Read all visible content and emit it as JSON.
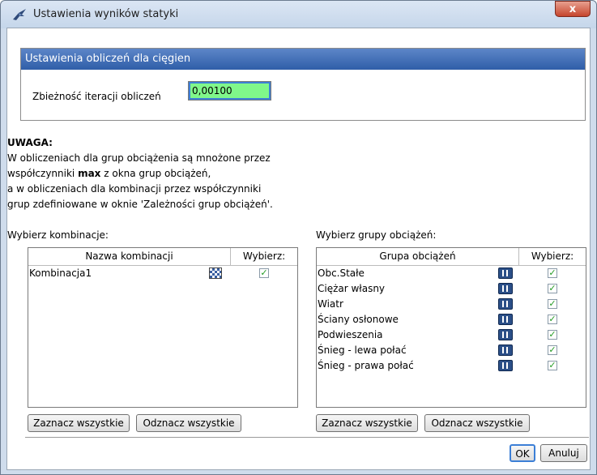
{
  "window": {
    "title": "Ustawienia wyników statyki",
    "close_label": "x"
  },
  "panel": {
    "header": "Ustawienia obliczeń dla cięgien",
    "convergence_label": "Zbieżność iteracji obliczeń",
    "convergence_value": "0,00100"
  },
  "note": {
    "title": "UWAGA:",
    "line1": "W obliczeniach dla grup obciążenia są mnożone przez",
    "line2_pre": "współczynniki ",
    "line2_bold": "max",
    "line2_post": " z okna grup obciążeń,",
    "line3": "a w obliczeniach dla kombinacji przez współczynniki",
    "line4": "grup zdefiniowane w oknie 'Zależności grup obciążeń'."
  },
  "combinations": {
    "label": "Wybierz kombinacje:",
    "col_name": "Nazwa kombinacji",
    "col_select": "Wybierz:",
    "rows": [
      {
        "name": "Kombinacja1",
        "checked": true
      }
    ],
    "select_all": "Zaznacz wszystkie",
    "deselect_all": "Odznacz wszystkie"
  },
  "groups": {
    "label": "Wybierz grupy obciążeń:",
    "col_name": "Grupa obciążeń",
    "col_select": "Wybierz:",
    "rows": [
      {
        "name": "Obc.Stałe",
        "checked": true
      },
      {
        "name": "Ciężar własny",
        "checked": true
      },
      {
        "name": "Wiatr",
        "checked": true
      },
      {
        "name": "Ściany osłonowe",
        "checked": true
      },
      {
        "name": "Podwieszenia",
        "checked": true
      },
      {
        "name": "Śnieg - lewa połać",
        "checked": true
      },
      {
        "name": "Śnieg - prawa połać",
        "checked": true
      }
    ],
    "select_all": "Zaznacz wszystkie",
    "deselect_all": "Odznacz wszystkie"
  },
  "footer": {
    "ok": "OK",
    "cancel": "Anuluj"
  },
  "colors": {
    "header_blue": "#2f5ea8",
    "input_green": "#80f78a",
    "check_green": "#229a22"
  },
  "icons": {
    "app": "bird-icon",
    "group": "load-group-icon",
    "combination": "combination-icon"
  }
}
